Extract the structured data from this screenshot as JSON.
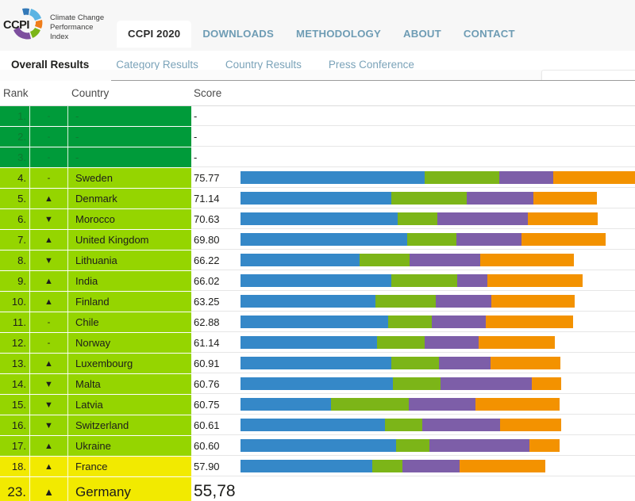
{
  "brand": {
    "acronym": "CCPI",
    "name_line1": "Climate Change",
    "name_line2": "Performance",
    "name_line3": "Index",
    "colors": {
      "blue_dark": "#3379b8",
      "blue_light": "#5ab4e3",
      "orange": "#ef7d1a",
      "green": "#7cb518",
      "purple": "#7d4f9e"
    }
  },
  "main_nav": [
    {
      "label": "CCPI 2020",
      "active": true
    },
    {
      "label": "DOWNLOADS",
      "active": false
    },
    {
      "label": "METHODOLOGY",
      "active": false
    },
    {
      "label": "ABOUT",
      "active": false
    },
    {
      "label": "CONTACT",
      "active": false
    }
  ],
  "sub_nav": [
    {
      "label": "Overall Results",
      "active": true
    },
    {
      "label": "Category Results",
      "active": false
    },
    {
      "label": "Country Results",
      "active": false
    },
    {
      "label": "Press Conference",
      "active": false
    }
  ],
  "table": {
    "headers": {
      "rank": "Rank",
      "country": "Country",
      "score": "Score"
    },
    "placeholder": "-",
    "arrow_up": "▲",
    "arrow_down": "▼",
    "arrow_none": "-",
    "rows": [
      {
        "rank": "1.",
        "trend": "none",
        "country": "-",
        "score": "-",
        "band": "dark",
        "segments": []
      },
      {
        "rank": "2.",
        "trend": "none",
        "country": "-",
        "score": "-",
        "band": "dark",
        "segments": []
      },
      {
        "rank": "3.",
        "trend": "none",
        "country": "-",
        "score": "-",
        "band": "dark",
        "segments": []
      },
      {
        "rank": "4.",
        "trend": "none",
        "country": "Sweden",
        "score": "75.77",
        "band": "light",
        "segments": [
          232,
          94,
          68,
          125
        ]
      },
      {
        "rank": "5.",
        "trend": "up",
        "country": "Denmark",
        "score": "71.14",
        "band": "light",
        "segments": [
          190,
          95,
          84,
          80
        ]
      },
      {
        "rank": "6.",
        "trend": "down",
        "country": "Morocco",
        "score": "70.63",
        "band": "light",
        "segments": [
          198,
          50,
          114,
          88
        ]
      },
      {
        "rank": "7.",
        "trend": "up",
        "country": "United Kingdom",
        "score": "69.80",
        "band": "light",
        "segments": [
          210,
          62,
          82,
          106
        ]
      },
      {
        "rank": "8.",
        "trend": "down",
        "country": "Lithuania",
        "score": "66.22",
        "band": "light",
        "segments": [
          150,
          63,
          89,
          118
        ]
      },
      {
        "rank": "9.",
        "trend": "up",
        "country": "India",
        "score": "66.02",
        "band": "light",
        "segments": [
          190,
          83,
          38,
          120
        ]
      },
      {
        "rank": "10.",
        "trend": "up",
        "country": "Finland",
        "score": "63.25",
        "band": "light",
        "segments": [
          170,
          76,
          70,
          105
        ]
      },
      {
        "rank": "11.",
        "trend": "none",
        "country": "Chile",
        "score": "62.88",
        "band": "light",
        "segments": [
          186,
          55,
          68,
          110
        ]
      },
      {
        "rank": "12.",
        "trend": "none",
        "country": "Norway",
        "score": "61.14",
        "band": "light",
        "segments": [
          172,
          60,
          68,
          96
        ]
      },
      {
        "rank": "13.",
        "trend": "up",
        "country": "Luxembourg",
        "score": "60.91",
        "band": "light",
        "segments": [
          190,
          60,
          65,
          88
        ]
      },
      {
        "rank": "14.",
        "trend": "down",
        "country": "Malta",
        "score": "60.76",
        "band": "light",
        "segments": [
          192,
          60,
          115,
          37
        ]
      },
      {
        "rank": "15.",
        "trend": "down",
        "country": "Latvia",
        "score": "60.75",
        "band": "light",
        "segments": [
          114,
          98,
          84,
          106
        ]
      },
      {
        "rank": "16.",
        "trend": "down",
        "country": "Switzerland",
        "score": "60.61",
        "band": "light",
        "segments": [
          182,
          47,
          98,
          77
        ]
      },
      {
        "rank": "17.",
        "trend": "up",
        "country": "Ukraine",
        "score": "60.60",
        "band": "light",
        "segments": [
          196,
          42,
          126,
          38
        ]
      },
      {
        "rank": "18.",
        "trend": "up",
        "country": "France",
        "score": "57.90",
        "band": "yellow",
        "segments": [
          166,
          38,
          72,
          108
        ]
      },
      {
        "rank": "23.",
        "trend": "up",
        "country": "Germany",
        "score": "55,78",
        "band": "yellow",
        "segments": [],
        "highlight": true
      }
    ],
    "bar_colors": {
      "ghg_emissions": "#3588c8",
      "renewable_energy": "#7cb518",
      "energy_use": "#7d5ea8",
      "climate_policy": "#f39200"
    },
    "band_colors": {
      "dark": "#009b3a",
      "light": "#95d500",
      "yellow": "#f2ea00"
    }
  }
}
